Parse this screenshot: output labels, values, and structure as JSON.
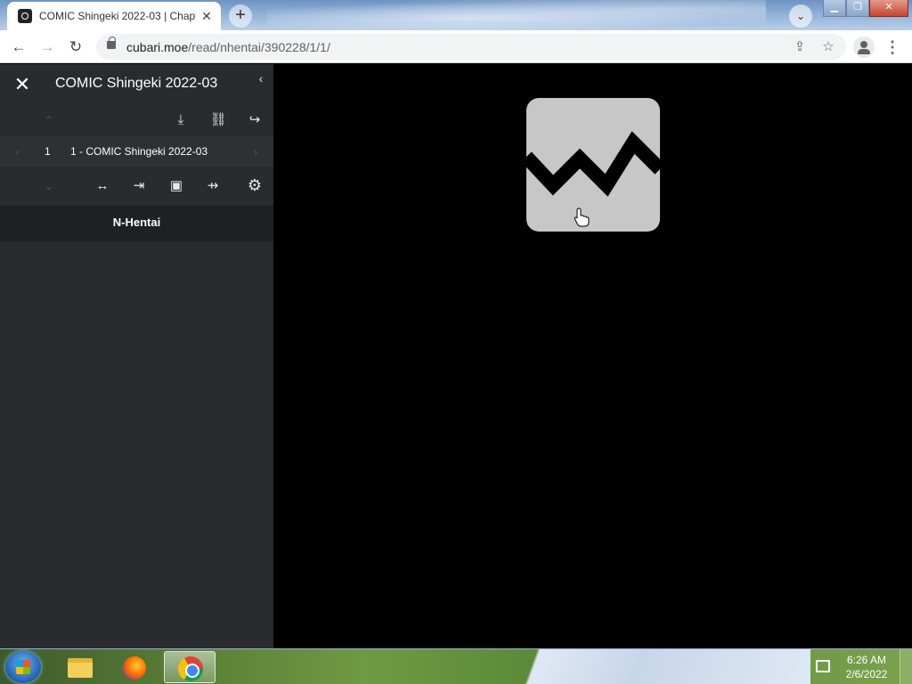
{
  "browser": {
    "tab_title": "COMIC Shingeki 2022-03 | Chapt",
    "tab_close": "✕",
    "new_tab": "+",
    "tab_search": "⌄",
    "url_host": "cubari.moe",
    "url_path": "/read/nhentai/390228/1/1/",
    "back": "←",
    "forward": "→",
    "reload": "↻",
    "share": "⇪",
    "bookmark": "☆",
    "menu": "⋮"
  },
  "window_controls": {
    "minimize": "▁",
    "maximize": "❐",
    "close": "✕"
  },
  "sidebar": {
    "close": "✕",
    "title": "COMIC Shingeki 2022-03",
    "collapse": "‹",
    "row1": {
      "up": "⌃",
      "download": "⤓",
      "link": "⛓",
      "share": "↪"
    },
    "chapter": {
      "prev": "‹",
      "number": "1",
      "title": "1 - COMIC Shingeki 2022-03",
      "next": "›"
    },
    "row3": {
      "down": "⌄",
      "fit_width": "↔",
      "fit_right": "⇥",
      "image": "▣",
      "single_page": "⇸",
      "settings": "⚙"
    },
    "group": "N-Hentai"
  },
  "main": {
    "state": "broken-image"
  },
  "taskbar": {
    "time": "6:26 AM",
    "date": "2/6/2022",
    "apps": [
      "start-button",
      "explorer-icon",
      "firefox-icon",
      "chrome-icon"
    ]
  },
  "colors": {
    "sidebar_bg": "#2a2b2e",
    "main_bg": "#000000",
    "broken_image_fill": "#c7c7c7"
  }
}
